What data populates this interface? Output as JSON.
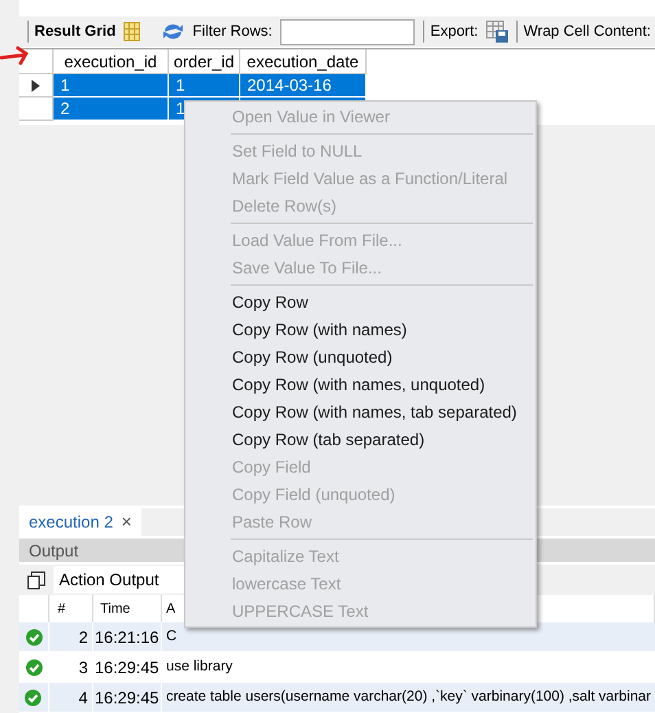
{
  "toolbar": {
    "result_grid": "Result Grid",
    "filter_label": "Filter Rows:",
    "export_label": "Export:",
    "wrap_label": "Wrap Cell Content:"
  },
  "grid": {
    "columns": [
      "execution_id",
      "order_id",
      "execution_date"
    ],
    "rows": [
      {
        "cells": [
          "1",
          "1",
          "2014-03-16"
        ],
        "selected": true,
        "current": true
      },
      {
        "cells": [
          "2",
          "1",
          ""
        ],
        "selected": true,
        "current": false
      }
    ]
  },
  "context_menu": [
    {
      "kind": "item",
      "label": "Open Value in Viewer",
      "disabled": true
    },
    {
      "kind": "separator"
    },
    {
      "kind": "item",
      "label": "Set Field to NULL",
      "disabled": true
    },
    {
      "kind": "item",
      "label": "Mark Field Value as a Function/Literal",
      "disabled": true
    },
    {
      "kind": "item",
      "label": "Delete Row(s)",
      "disabled": true
    },
    {
      "kind": "separator"
    },
    {
      "kind": "item",
      "label": "Load Value From File...",
      "disabled": true
    },
    {
      "kind": "item",
      "label": "Save Value To File...",
      "disabled": true
    },
    {
      "kind": "separator"
    },
    {
      "kind": "item",
      "label": "Copy Row",
      "disabled": false
    },
    {
      "kind": "item",
      "label": "Copy Row (with names)",
      "disabled": false
    },
    {
      "kind": "item",
      "label": "Copy Row (unquoted)",
      "disabled": false
    },
    {
      "kind": "item",
      "label": "Copy Row (with names, unquoted)",
      "disabled": false
    },
    {
      "kind": "item",
      "label": "Copy Row (with names, tab separated)",
      "disabled": false
    },
    {
      "kind": "item",
      "label": "Copy Row (tab separated)",
      "disabled": false
    },
    {
      "kind": "item",
      "label": "Copy Field",
      "disabled": true
    },
    {
      "kind": "item",
      "label": "Copy Field (unquoted)",
      "disabled": true
    },
    {
      "kind": "item",
      "label": "Paste Row",
      "disabled": true
    },
    {
      "kind": "separator"
    },
    {
      "kind": "item",
      "label": "Capitalize Text",
      "disabled": true
    },
    {
      "kind": "item",
      "label": "lowercase Text",
      "disabled": true
    },
    {
      "kind": "item",
      "label": "UPPERCASE Text",
      "disabled": true
    }
  ],
  "result_tab": {
    "label": "execution 2",
    "close": "×"
  },
  "output": {
    "title": "Output",
    "selector": "Action Output",
    "columns": [
      "#",
      "Time",
      "A"
    ],
    "rows": [
      {
        "success": true,
        "number": "2",
        "time": "16:21:16",
        "action": "C"
      },
      {
        "success": true,
        "number": "3",
        "time": "16:29:45",
        "action": "use library"
      },
      {
        "success": true,
        "number": "4",
        "time": "16:29:45",
        "action": "create table users(username varchar(20) ,`key` varbinary(100) ,salt varbinar"
      }
    ]
  }
}
